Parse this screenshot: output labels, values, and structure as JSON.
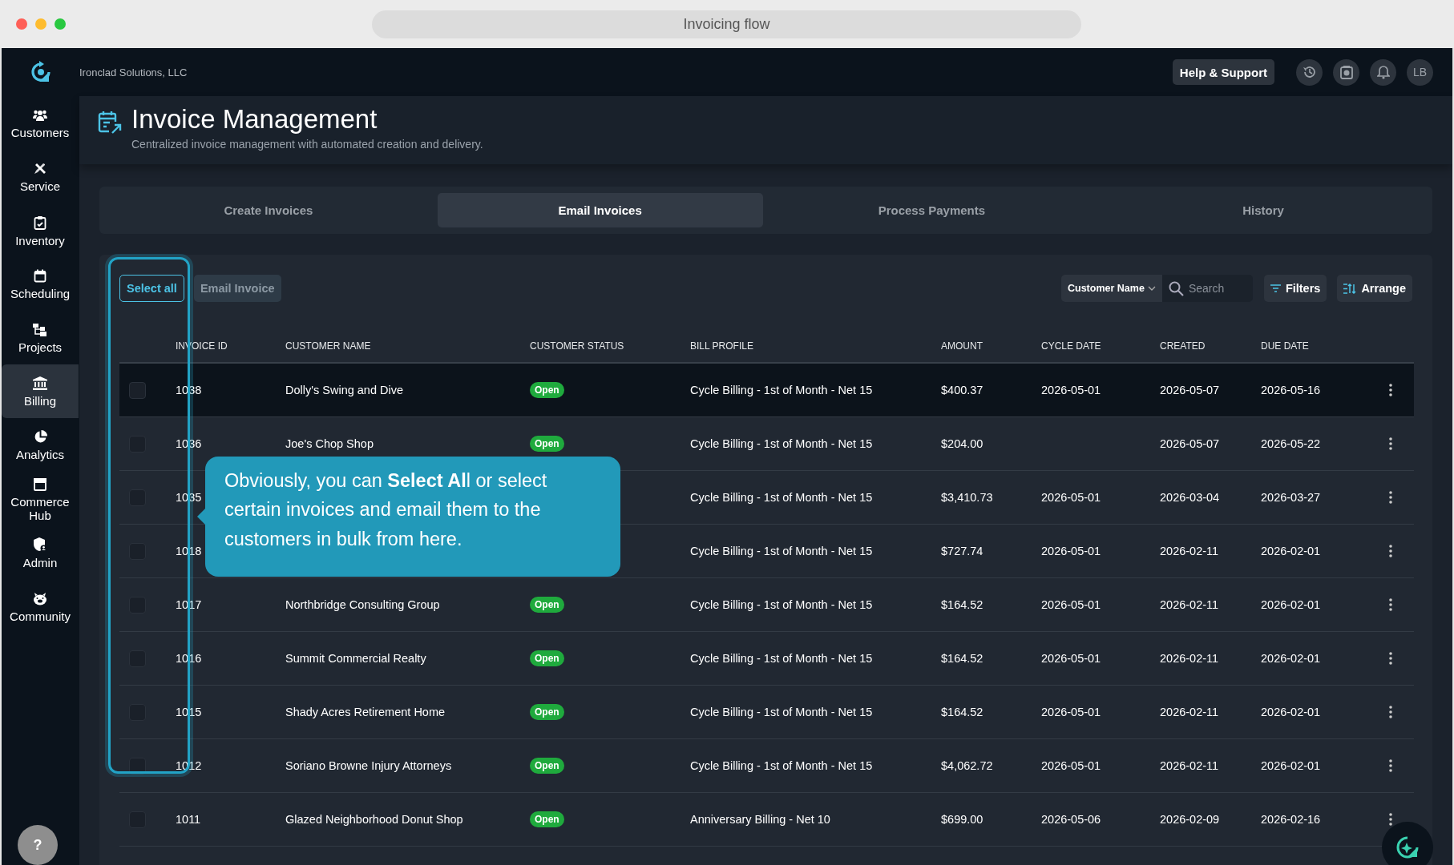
{
  "window": {
    "title": "Invoicing flow"
  },
  "topbar": {
    "company": "Ironclad Solutions, LLC",
    "help_button": "Help & Support",
    "avatar": "LB"
  },
  "sidebar": {
    "items": [
      {
        "label": "Customers",
        "selected": false
      },
      {
        "label": "Service",
        "selected": false
      },
      {
        "label": "Inventory",
        "selected": false
      },
      {
        "label": "Scheduling",
        "selected": false
      },
      {
        "label": "Projects",
        "selected": false
      },
      {
        "label": "Billing",
        "selected": true
      },
      {
        "label": "Analytics",
        "selected": false
      },
      {
        "label": "Commerce Hub",
        "selected": false
      },
      {
        "label": "Admin",
        "selected": false
      },
      {
        "label": "Community",
        "selected": false
      }
    ],
    "help": "?"
  },
  "header": {
    "title": "Invoice Management",
    "subtitle": "Centralized invoice management with automated creation and delivery."
  },
  "tabs": [
    {
      "label": "Create Invoices",
      "selected": false
    },
    {
      "label": "Email Invoices",
      "selected": true
    },
    {
      "label": "Process Payments",
      "selected": false
    },
    {
      "label": "History",
      "selected": false
    }
  ],
  "toolbar": {
    "select_all": "Select all",
    "email_invoice": {
      "label": "Email Invoice",
      "disabled": true
    },
    "sort_field": "Customer Name",
    "search": {
      "placeholder": "Search"
    },
    "filters": "Filters",
    "arrange": "Arrange"
  },
  "table": {
    "columns": [
      "INVOICE ID",
      "CUSTOMER NAME",
      "CUSTOMER STATUS",
      "BILL PROFILE",
      "AMOUNT",
      "CYCLE DATE",
      "CREATED",
      "DUE DATE"
    ],
    "rows": [
      {
        "invoice_id": "1038",
        "customer_name": "Dolly's Swing and Dive",
        "customer_status": "Open",
        "bill_profile": "Cycle Billing - 1st of Month - Net 15",
        "amount": "$400.37",
        "cycle_date": "2026-05-01",
        "created": "2026-05-07",
        "due_date": "2026-05-16",
        "checked": false,
        "highlighted": true
      },
      {
        "invoice_id": "1036",
        "customer_name": "Joe's Chop Shop",
        "customer_status": "Open",
        "bill_profile": "Cycle Billing - 1st of Month - Net 15",
        "amount": "$204.00",
        "created": "2026-05-07",
        "due_date": "2026-05-22",
        "checked": false,
        "highlighted": false
      },
      {
        "invoice_id": "1035",
        "bill_profile": "Cycle Billing - 1st of Month - Net 15",
        "amount": "$3,410.73",
        "cycle_date": "2026-05-01",
        "created": "2026-03-04",
        "due_date": "2026-03-27",
        "checked": false,
        "highlighted": false
      },
      {
        "invoice_id": "1018",
        "bill_profile": "Cycle Billing - 1st of Month - Net 15",
        "amount": "$727.74",
        "cycle_date": "2026-05-01",
        "created": "2026-02-11",
        "due_date": "2026-02-01",
        "checked": false,
        "highlighted": false
      },
      {
        "invoice_id": "1017",
        "customer_name": "Northbridge Consulting Group",
        "customer_status": "Open",
        "bill_profile": "Cycle Billing - 1st of Month - Net 15",
        "amount": "$164.52",
        "cycle_date": "2026-05-01",
        "created": "2026-02-11",
        "due_date": "2026-02-01",
        "checked": false,
        "highlighted": false
      },
      {
        "invoice_id": "1016",
        "customer_name": "Summit Commercial Realty",
        "customer_status": "Open",
        "bill_profile": "Cycle Billing - 1st of Month - Net 15",
        "amount": "$164.52",
        "cycle_date": "2026-05-01",
        "created": "2026-02-11",
        "due_date": "2026-02-01",
        "checked": false,
        "highlighted": false
      },
      {
        "invoice_id": "1015",
        "customer_name": "Shady Acres Retirement Home",
        "customer_status": "Open",
        "bill_profile": "Cycle Billing - 1st of Month - Net 15",
        "amount": "$164.52",
        "cycle_date": "2026-05-01",
        "created": "2026-02-11",
        "due_date": "2026-02-01",
        "checked": false,
        "highlighted": false
      },
      {
        "invoice_id": "1012",
        "customer_name": "Soriano Browne Injury Attorneys",
        "customer_status": "Open",
        "bill_profile": "Cycle Billing - 1st of Month - Net 15",
        "amount": "$4,062.72",
        "cycle_date": "2026-05-01",
        "created": "2026-02-11",
        "due_date": "2026-02-01",
        "checked": false,
        "highlighted": false
      },
      {
        "invoice_id": "1011",
        "customer_name": "Glazed Neighborhood Donut Shop",
        "customer_status": "Open",
        "bill_profile": "Anniversary Billing - Net 10",
        "amount": "$699.00",
        "cycle_date": "2026-05-06",
        "created": "2026-02-09",
        "due_date": "2026-02-16",
        "checked": false,
        "highlighted": false
      }
    ]
  },
  "tooltip": {
    "text": "Obviously, you can **Select Al**l or select certain invoices and email them to the customers in bulk from here."
  }
}
